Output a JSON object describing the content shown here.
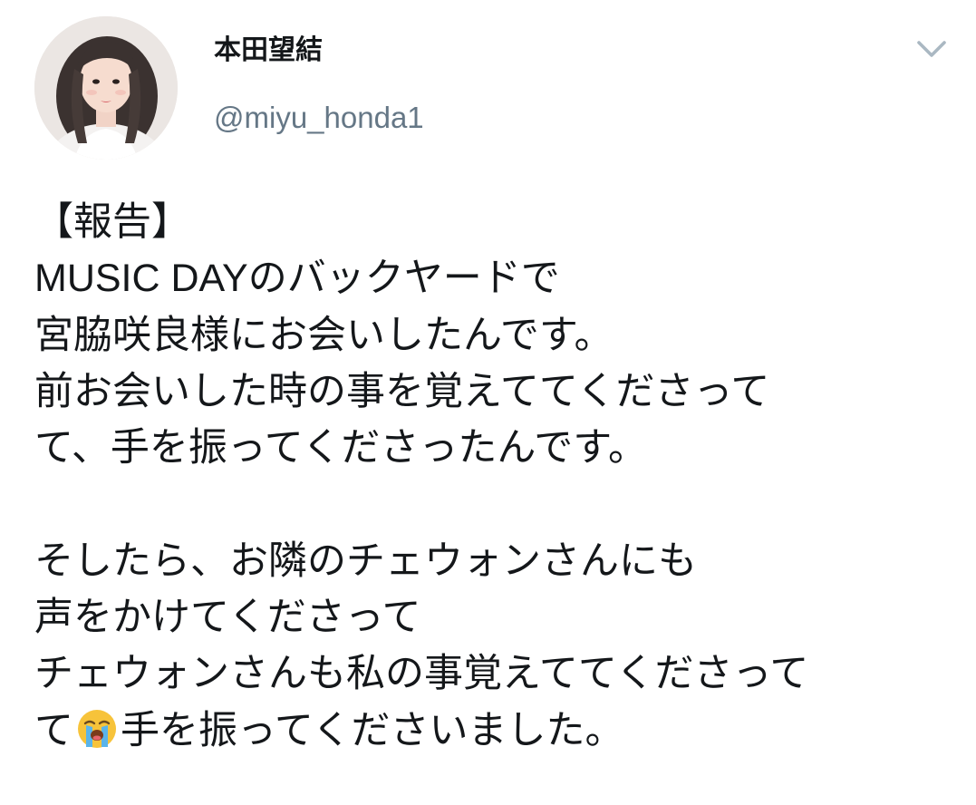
{
  "tweet": {
    "display_name": "本田望結",
    "handle": "@miyu_honda1",
    "avatar_icon": "profile-photo",
    "menu_icon": "chevron-down-icon",
    "lines": [
      "【報告】",
      "MUSIC DAYのバックヤードで",
      "宮脇咲良様にお会いしたんです。",
      "前お会いした時の事を覚えててくださって",
      "て、手を振ってくださったんです。",
      "",
      "そしたら、お隣のチェウォンさんにも",
      "声をかけてくださって",
      "チェウォンさんも私の事覚えててくださって"
    ],
    "last_line_prefix": "て",
    "last_line_emoji": "loudly-crying-face-emoji",
    "last_line_suffix": "手を振ってくださいました。"
  },
  "colors": {
    "text": "#14171a",
    "secondary": "#657786",
    "caret": "#aab8c2"
  }
}
